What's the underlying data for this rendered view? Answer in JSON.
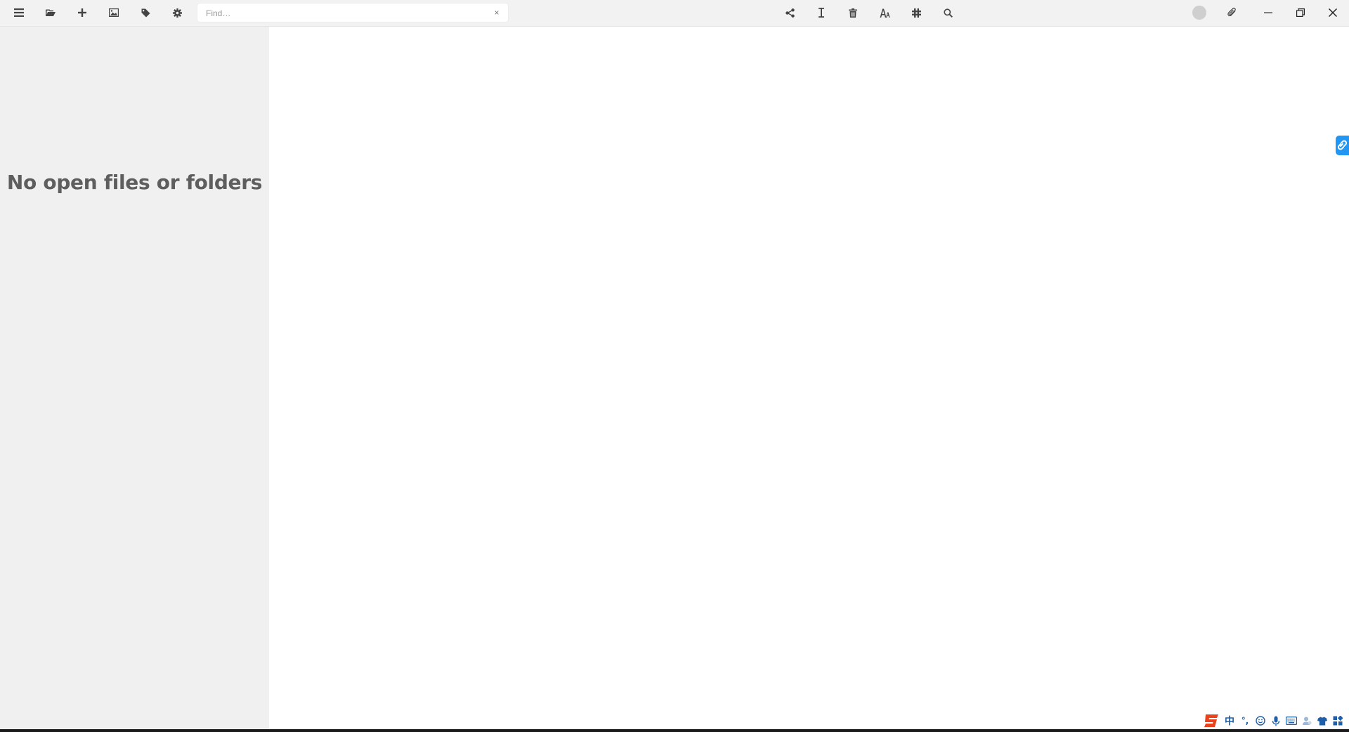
{
  "toolbar": {
    "find_placeholder": "Find…",
    "find_value": "",
    "find_clear_label": "×"
  },
  "sidebar": {
    "empty_message": "No open files or folders"
  },
  "ime": {
    "language_label": "中",
    "punctuation_label": "°,"
  },
  "icons": {
    "left": [
      "menu-icon",
      "folder-open-icon",
      "plus-icon",
      "image-icon",
      "tag-icon",
      "gear-icon"
    ],
    "center": [
      "share-icon",
      "text-cursor-icon",
      "trash-icon",
      "font-icon",
      "hashtag-icon",
      "search-icon"
    ],
    "right": [
      "avatar",
      "paperclip-icon",
      "minimize-icon",
      "restore-icon",
      "close-icon"
    ]
  },
  "colors": {
    "toolbar_bg": "#f2f2f2",
    "sidebar_bg": "#f0f0f0",
    "editor_bg": "#ffffff",
    "accent": "#2196f3",
    "ime_logo": "#e8431c"
  }
}
